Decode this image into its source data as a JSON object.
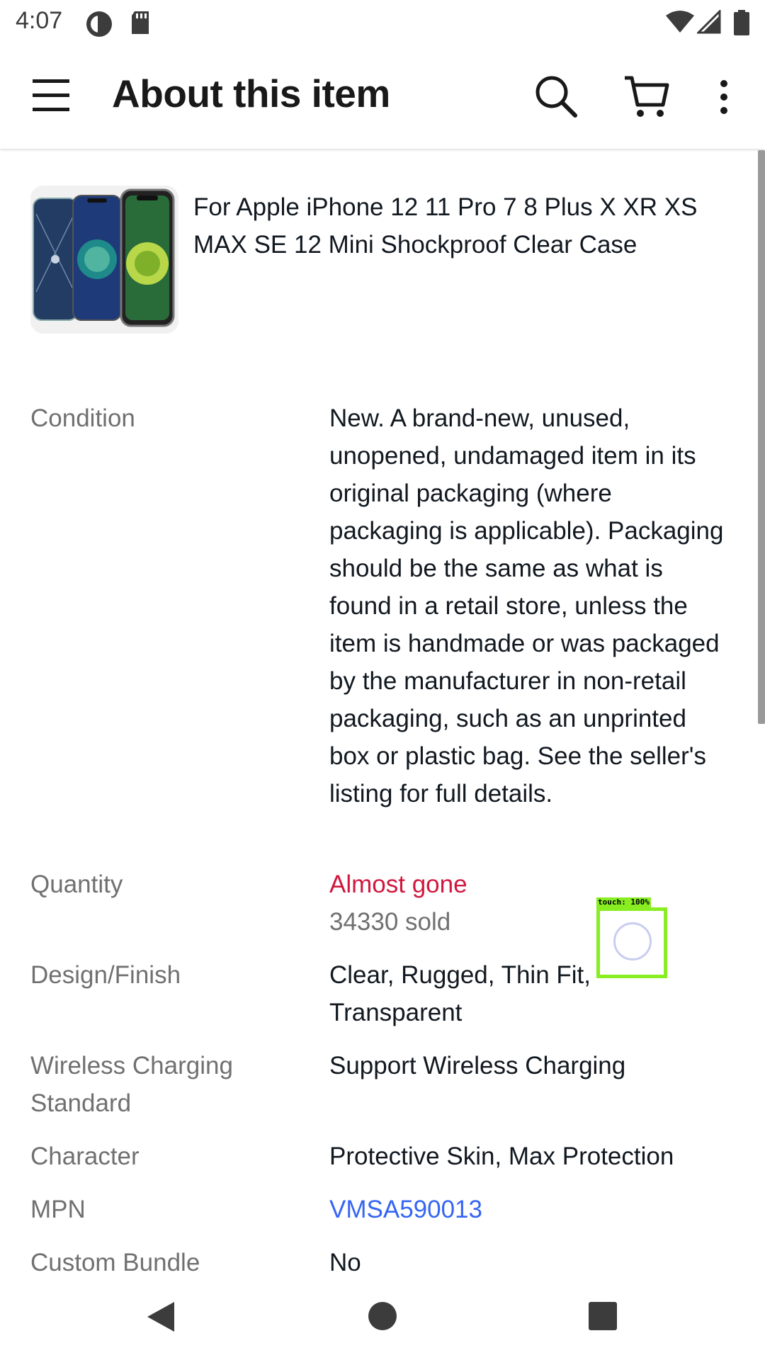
{
  "status_bar": {
    "time": "4:07",
    "icons": [
      "sync-icon",
      "sd-card-icon",
      "wifi-icon",
      "signal-icon",
      "battery-icon"
    ]
  },
  "app_bar": {
    "title": "About this item",
    "icons": [
      "menu-icon",
      "search-icon",
      "cart-icon",
      "more-vert-icon"
    ]
  },
  "item": {
    "title": "For Apple iPhone 12 11 Pro 7 8 Plus X XR XS MAX SE 12 Mini Shockproof Clear Case",
    "thumbnail": "phone-case-thumbnail"
  },
  "specs": {
    "condition": {
      "label": "Condition",
      "value": "New. A brand-new, unused, unopened, undamaged item in its original packaging (where packaging is applicable). Packaging should be the same as what is found in a retail store, unless the item is handmade or was packaged by the manufacturer in non-retail packaging, such as an unprinted box or plastic bag. See the seller's listing for full details."
    },
    "quantity": {
      "label": "Quantity",
      "status": "Almost gone",
      "sold": "34330 sold"
    },
    "design": {
      "label": "Design/Finish",
      "value": "Clear, Rugged, Thin Fit, Transparent"
    },
    "wireless": {
      "label": "Wireless Charging Standard",
      "value": "Support Wireless Charging"
    },
    "character": {
      "label": "Character",
      "value": "Protective Skin, Max Protection"
    },
    "mpn": {
      "label": "MPN",
      "value": "VMSA590013"
    },
    "bundle": {
      "label": "Custom Bundle",
      "value": "No"
    }
  },
  "touch_indicator": {
    "label": "touch: 100%"
  },
  "colors": {
    "red": "#d0183f",
    "link": "#3665f3",
    "label_gray": "#707070",
    "touch_green": "#88ee22"
  }
}
